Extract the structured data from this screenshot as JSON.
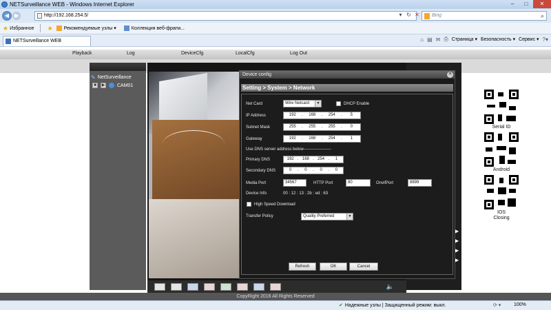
{
  "browser": {
    "window_title": "NETSurveillance WEB - Windows Internet Explorer",
    "url": "http://192.168.254.5/",
    "search_placeholder": "Bing",
    "favorites_label": "Избранное",
    "fav_items": [
      "Рекомендуемые узлы ▾",
      "Коллекция веб-фрагм..."
    ],
    "tab_title": "NETSurveillance WEB",
    "commands": [
      "Страница ▾",
      "Безопасность ▾",
      "Сервис ▾"
    ],
    "status_zone": "Надежные узлы | Защищенный режим: выкл.",
    "zoom": "100%"
  },
  "app": {
    "nav": [
      "Playback",
      "Log",
      "DeviceCfg",
      "LocalCfg",
      "Log Out"
    ],
    "device_name": "NetSurveillance",
    "camera": "CAM01",
    "copyright": "CopyRight 2016 All Rights Reserved",
    "qr_labels": [
      "Serial ID",
      "Android",
      "IOS"
    ],
    "closing": "Closing"
  },
  "dialog": {
    "title": "Device config",
    "breadcrumb": "Setting > System > Network",
    "net_card_label": "Net Card",
    "net_card_value": "Wire Netcard",
    "dhcp_label": "DHCP Enable",
    "ip_label": "IP Address",
    "ip": [
      "192",
      "168",
      "254",
      "5"
    ],
    "mask_label": "Subnet Mask",
    "mask": [
      "255",
      "255",
      "255",
      "0"
    ],
    "gateway_label": "Gateway",
    "gateway": [
      "192",
      "168",
      "254",
      "1"
    ],
    "dns_header": "Use DNS server address below--------------------",
    "primary_dns_label": "Primary DNS",
    "primary_dns": [
      "192",
      "168",
      "254",
      "1"
    ],
    "secondary_dns_label": "Secondary DNS",
    "secondary_dns": [
      "0",
      "0",
      "0",
      "0"
    ],
    "media_port_label": "Media Port",
    "media_port": "34567",
    "http_port_label": "HTTP Port",
    "http_port": "80",
    "onvif_port_label": "OnvifPort",
    "onvif_port": "8899",
    "device_info_label": "Device Info",
    "device_info": "00 : 12 : 13 : 2b : ed : 63",
    "high_speed_label": "High Speed Download",
    "transfer_policy_label": "Transfer Policy",
    "transfer_policy_value": "Quality Preferred",
    "refresh": "Refresh",
    "ok": "OK",
    "cancel": "Cancel"
  },
  "colors": {
    "dialog_bg": "#1a1a1a",
    "breadcrumb_bg": "#7a7a7a",
    "ie_blue": "#dde8f5"
  }
}
